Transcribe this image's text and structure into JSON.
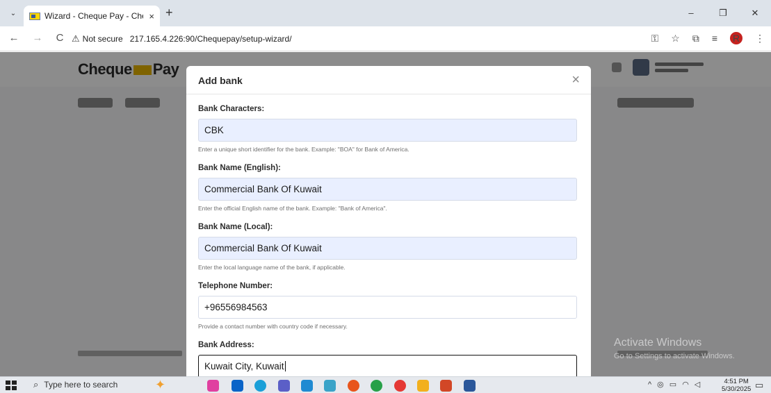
{
  "browser": {
    "tab_title": "Wizard - Cheque Pay - Cheque",
    "tab_close": "×",
    "new_tab": "+",
    "window_controls": {
      "minimize": "–",
      "restore": "❐",
      "close": "✕"
    },
    "nav": {
      "back": "←",
      "forward": "→",
      "reload": "C"
    },
    "security_label": "Not secure",
    "url": "217.165.4.226:90/Chequepay/setup-wizard/",
    "profile_initial": "R"
  },
  "modal": {
    "title": "Add bank",
    "close": "×",
    "fields": [
      {
        "label": "Bank Characters:",
        "value": "CBK",
        "help": "Enter a unique short identifier for the bank. Example: \"BOA\" for Bank of America."
      },
      {
        "label": "Bank Name (English):",
        "value": "Commercial Bank Of Kuwait",
        "help": "Enter the official English name of the bank. Example: \"Bank of America\"."
      },
      {
        "label": "Bank Name (Local):",
        "value": "Commercial Bank Of Kuwait",
        "help": "Enter the local language name of the bank, if applicable."
      },
      {
        "label": "Telephone Number:",
        "value": "+96556984563",
        "help": "Provide a contact number with country code if necessary."
      },
      {
        "label": "Bank Address:",
        "value": "Kuwait City, Kuwait"
      }
    ]
  },
  "watermark": {
    "title": "Activate Windows",
    "subtitle": "Go to Settings to activate Windows."
  },
  "taskbar": {
    "search_placeholder": "Type here to search",
    "time": "4:51 PM",
    "date": "5/30/2025"
  },
  "colors": {
    "input_fill": "#e9efff",
    "overlay": "rgba(0,0,0,0.45)",
    "profile": "#c5221f",
    "logo_mark": "#e8b400"
  }
}
